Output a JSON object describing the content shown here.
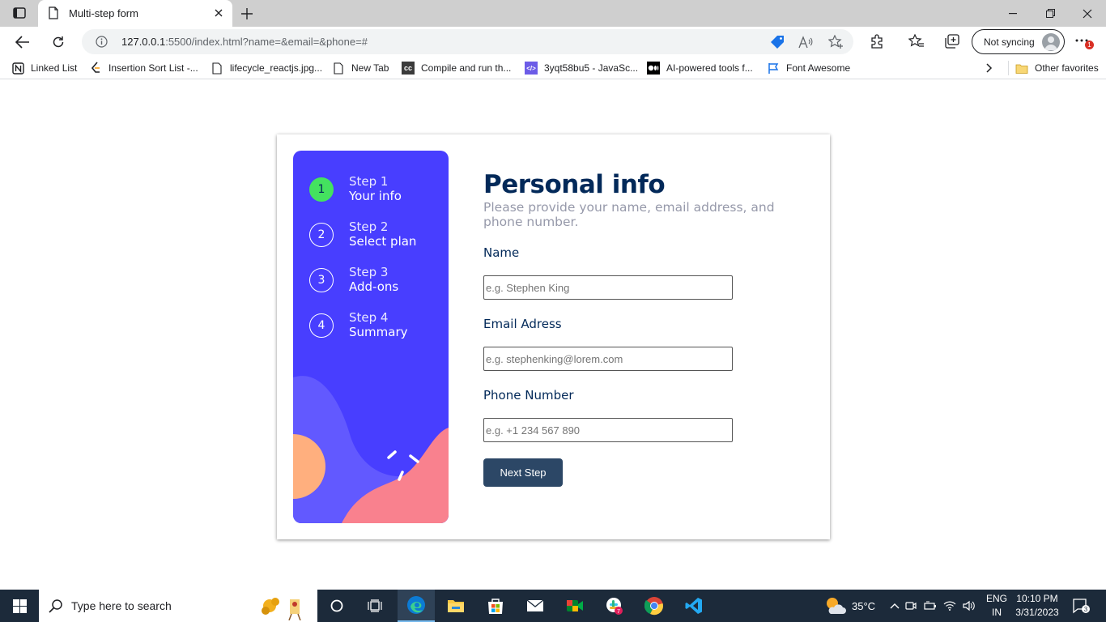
{
  "browser": {
    "tab_title": "Multi-step form",
    "url_host": "127.0.0.1",
    "url_rest": ":5500/index.html?name=&email=&phone=#",
    "profile_label": "Not syncing",
    "notification_count": "1"
  },
  "bookmarks": [
    {
      "label": "Linked List",
      "icon": "notion-icon"
    },
    {
      "label": "Insertion Sort List -...",
      "icon": "leetcode-icon"
    },
    {
      "label": "lifecycle_reactjs.jpg...",
      "icon": "page-icon"
    },
    {
      "label": "New Tab",
      "icon": "page-icon"
    },
    {
      "label": "Compile and run th...",
      "icon": "cc-icon"
    },
    {
      "label": "3yqt58bu5 - JavaSc...",
      "icon": "code-icon"
    },
    {
      "label": "AI-powered tools f...",
      "icon": "medium-icon"
    },
    {
      "label": "Font Awesome",
      "icon": "flag-icon"
    }
  ],
  "bookmarks_other": "Other favorites",
  "sidebar": {
    "steps": [
      {
        "number": "1",
        "title": "Step 1",
        "name": "Your info",
        "active": true
      },
      {
        "number": "2",
        "title": "Step 2",
        "name": "Select plan",
        "active": false
      },
      {
        "number": "3",
        "title": "Step 3",
        "name": "Add-ons",
        "active": false
      },
      {
        "number": "4",
        "title": "Step 4",
        "name": "Summary",
        "active": false
      }
    ]
  },
  "form": {
    "title": "Personal info",
    "subtitle": "Please provide your name, email address, and phone number.",
    "name_label": "Name",
    "name_placeholder": "e.g. Stephen King",
    "email_label": "Email Adress",
    "email_placeholder": "e.g. stephenking@lorem.com",
    "phone_label": "Phone Number",
    "phone_placeholder": "e.g. +1 234 567 890",
    "next_label": "Next Step"
  },
  "colors": {
    "sidebar_bg": "#483eff",
    "active_step": "#44e25f",
    "title": "#022959",
    "button_bg": "#2c4766"
  },
  "taskbar": {
    "search_placeholder": "Type here to search",
    "weather": "35°C",
    "lang_top": "ENG",
    "lang_bottom": "IN",
    "time": "10:10 PM",
    "date": "3/31/2023",
    "notifications": "3",
    "slack_badge": "7"
  }
}
